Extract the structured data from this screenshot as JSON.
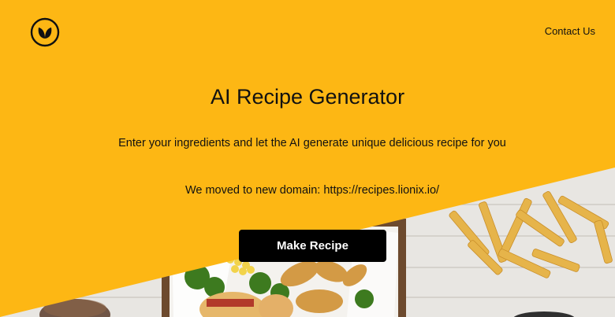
{
  "header": {
    "logo_icon": "leaf-icon",
    "contact_label": "Contact Us"
  },
  "hero": {
    "title": "AI Recipe Generator",
    "subtitle": "Enter your ingredients and let the AI generate unique delicious recipe for you",
    "domain_notice": "We moved to new domain: https://recipes.lionix.io/",
    "cta_label": "Make Recipe"
  },
  "colors": {
    "accent": "#FDB714",
    "text": "#111111",
    "button_bg": "#000000",
    "button_text": "#FFFFFF"
  }
}
